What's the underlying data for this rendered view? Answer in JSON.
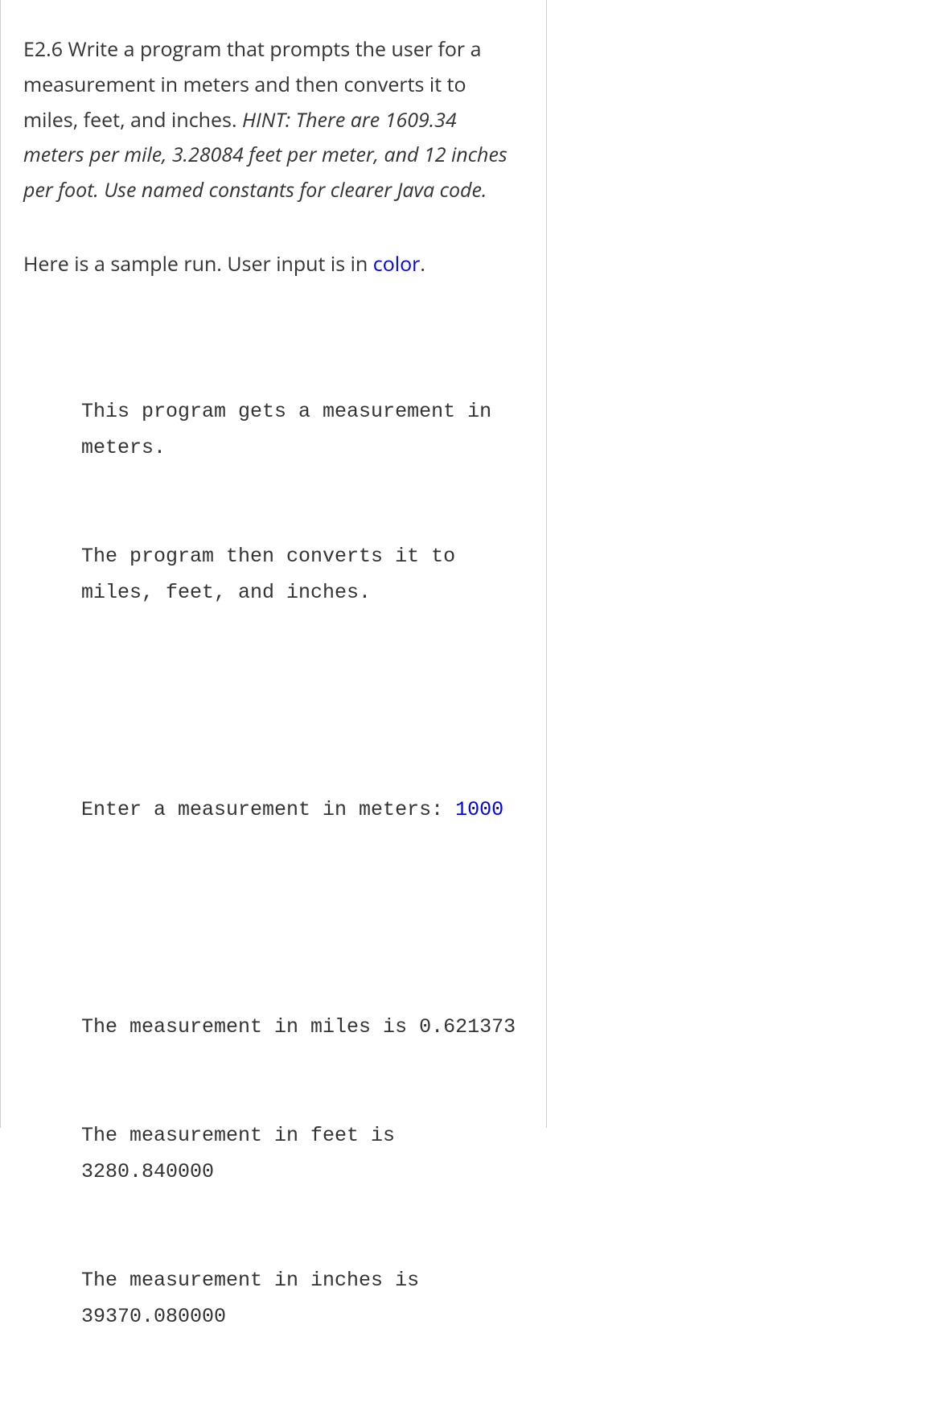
{
  "problem": {
    "main_text": "E2.6 Write a program that prompts the user for a measurement in meters and then converts it to miles, feet, and inches. ",
    "hint_text": "HINT: There are 1609.34 meters per mile, 3.28084 feet per meter, and 12 inches per foot.  Use named constants for clearer Java code."
  },
  "sample_intro": {
    "prefix": "Here is a sample run. User input is in ",
    "color_word": "color",
    "suffix": "."
  },
  "code": {
    "line1": "This program gets a measurement in meters.",
    "line2": "The program then converts it to miles, feet, and inches.",
    "prompt_prefix": "Enter a measurement in meters: ",
    "user_input": "1000",
    "result1": "The measurement in miles is 0.621373",
    "result2": "The measurement in feet is 3280.840000",
    "result3": "The measurement in inches is 39370.080000"
  }
}
